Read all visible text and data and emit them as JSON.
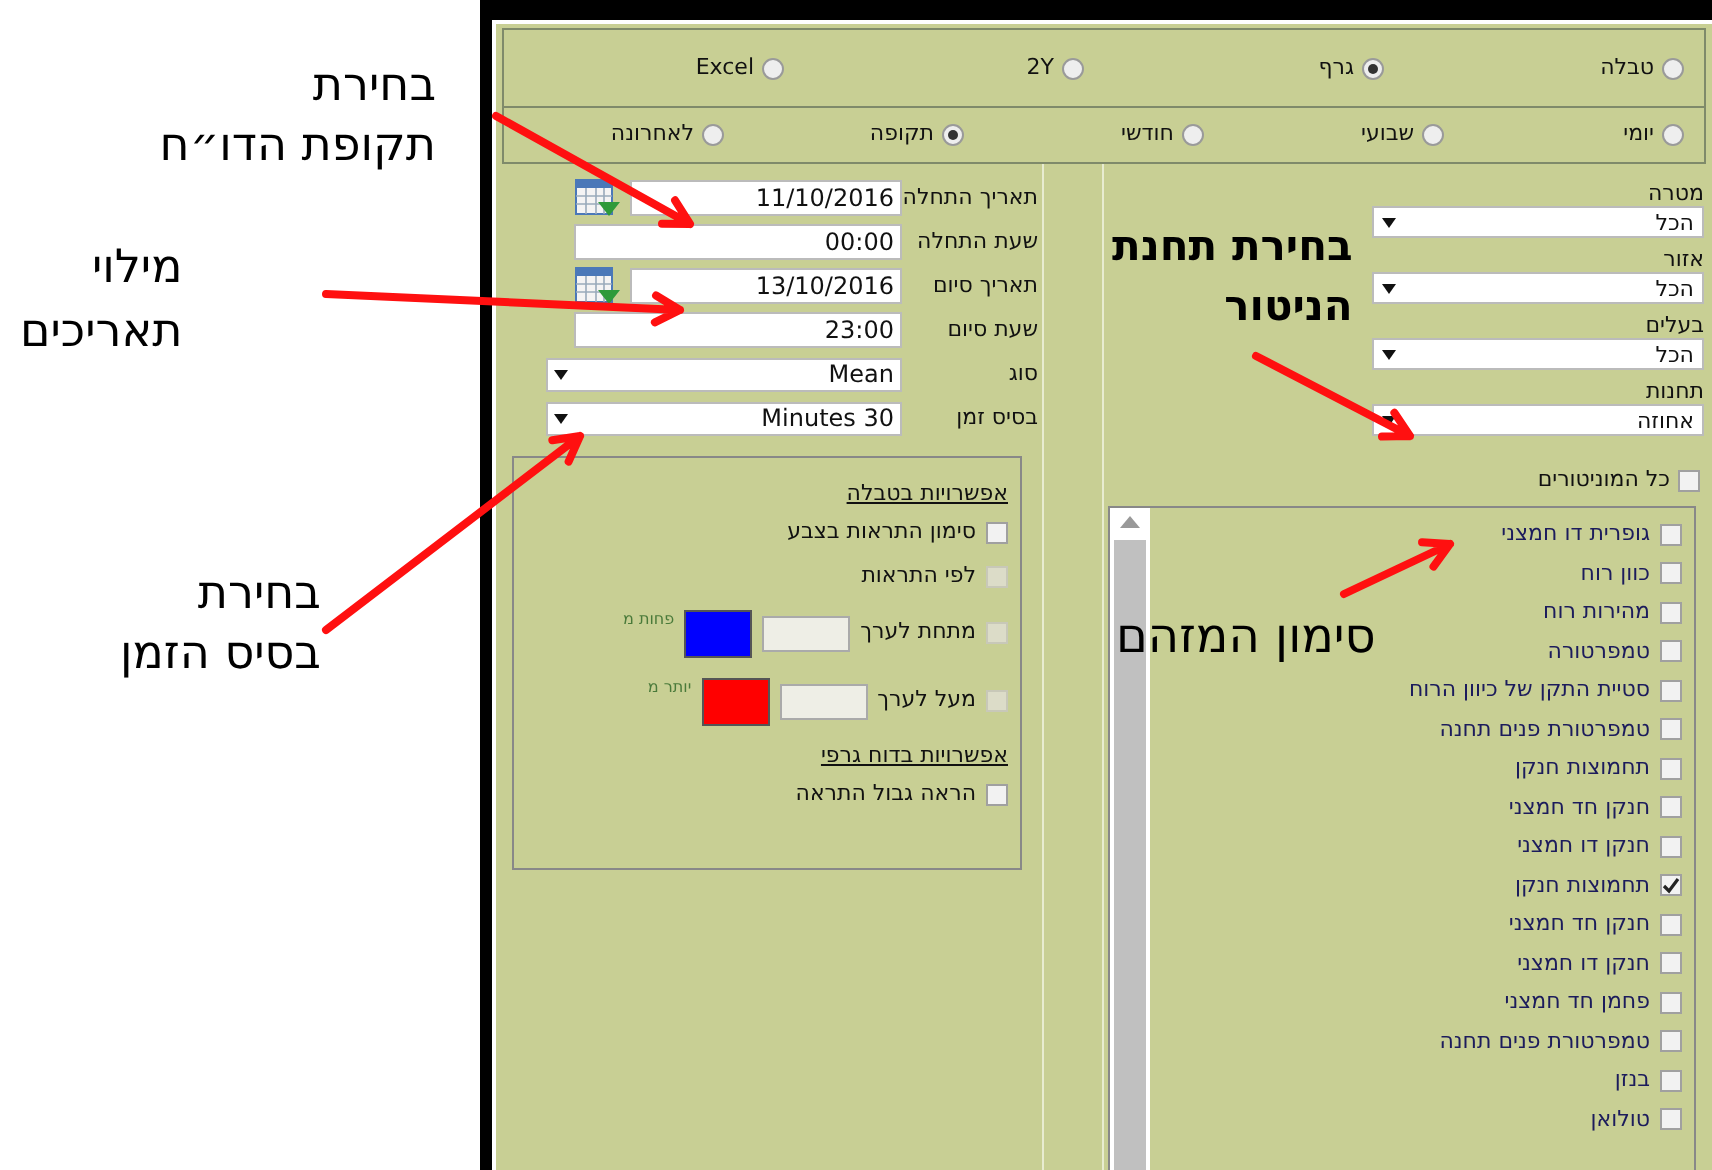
{
  "callouts": [
    {
      "kind": "plain",
      "lines": [
        "בחירת",
        "תקופת הדו״ח"
      ]
    },
    {
      "kind": "plain",
      "lines": [
        "מילוי",
        "תאריכים"
      ]
    },
    {
      "kind": "plain",
      "lines": [
        "בחירת",
        "בסיס הזמן"
      ]
    },
    {
      "kind": "bold",
      "lines": [
        "בחירת תחנת",
        "הניטור"
      ]
    },
    {
      "kind": "plain",
      "lines": [
        "סימון המזהם"
      ]
    }
  ],
  "report_types": [
    {
      "label": "טבלה",
      "selected": false
    },
    {
      "label": "גרף",
      "selected": true
    },
    {
      "label": "2Y",
      "selected": false
    },
    {
      "label": "Excel",
      "selected": false
    }
  ],
  "periods": [
    {
      "label": "יומי",
      "selected": false
    },
    {
      "label": "שבועי",
      "selected": false
    },
    {
      "label": "חודשי",
      "selected": false
    },
    {
      "label": "תקופה",
      "selected": true
    },
    {
      "label": "לאחרונה",
      "selected": false
    }
  ],
  "form_fields": [
    {
      "kind": "date",
      "label": "תאריך התחלה",
      "value": "11/10/2016"
    },
    {
      "kind": "text",
      "label": "שעת התחלה",
      "value": "00:00"
    },
    {
      "kind": "date",
      "label": "תאריך סיום",
      "value": "13/10/2016"
    },
    {
      "kind": "text",
      "label": "שעת סיום",
      "value": "23:00"
    },
    {
      "kind": "select",
      "label": "סוג",
      "value": "Mean"
    },
    {
      "kind": "select",
      "label": "בסיס זמן",
      "value": "Minutes 30"
    }
  ],
  "options": [
    {
      "kind": "heading",
      "label": "אפשרויות בטבלה"
    },
    {
      "kind": "checkbox",
      "label": "סימון התראות בצבע",
      "checked": false,
      "disabled": false
    },
    {
      "kind": "checkbox",
      "label": "לפי התראות",
      "checked": false,
      "disabled": true
    },
    {
      "kind": "threshold",
      "label": "מתחת לערך",
      "checked": false,
      "disabled": true,
      "color": "#0000ff",
      "note": "פחות מ"
    },
    {
      "kind": "threshold",
      "label": "מעל לערך",
      "checked": false,
      "disabled": true,
      "color": "#ff0000",
      "note": "יותר מ"
    },
    {
      "kind": "heading",
      "label": "אפשרויות בדוח גרפי"
    },
    {
      "kind": "checkbox",
      "label": "הראה גבול התראה",
      "checked": false,
      "disabled": false
    }
  ],
  "filters": [
    {
      "label": "מטרה",
      "value": "הכל"
    },
    {
      "label": "אזור",
      "value": "הכל"
    },
    {
      "label": "בעלים",
      "value": "הכל"
    },
    {
      "label": "תחנות",
      "value": "אחוזה"
    }
  ],
  "all_monitors": {
    "label": "כל המוניטורים",
    "checked": false
  },
  "pollutants": [
    {
      "label": "גופרית דו חמצני",
      "checked": false
    },
    {
      "label": "כוון רוח",
      "checked": false
    },
    {
      "label": "מהירות רוח",
      "checked": false
    },
    {
      "label": "טמפרטורה",
      "checked": false
    },
    {
      "label": "סטיית התקן של כיוון הרוח",
      "checked": false
    },
    {
      "label": "טמפרטורת פנים תחנה",
      "checked": false
    },
    {
      "label": "תחמוצות חנקן",
      "checked": false
    },
    {
      "label": "חנקן חד חמצני",
      "checked": false
    },
    {
      "label": "חנקן דו חמצני",
      "checked": false
    },
    {
      "label": "תחמוצות חנקן",
      "checked": true
    },
    {
      "label": "חנקן חד חמצני",
      "checked": false
    },
    {
      "label": "חנקן דו חמצני",
      "checked": false
    },
    {
      "label": "פחמן חד חמצני",
      "checked": false
    },
    {
      "label": "טמפרטורת פנים תחנה",
      "checked": false
    },
    {
      "label": "בנזן",
      "checked": false
    },
    {
      "label": "טולואן",
      "checked": false
    }
  ]
}
